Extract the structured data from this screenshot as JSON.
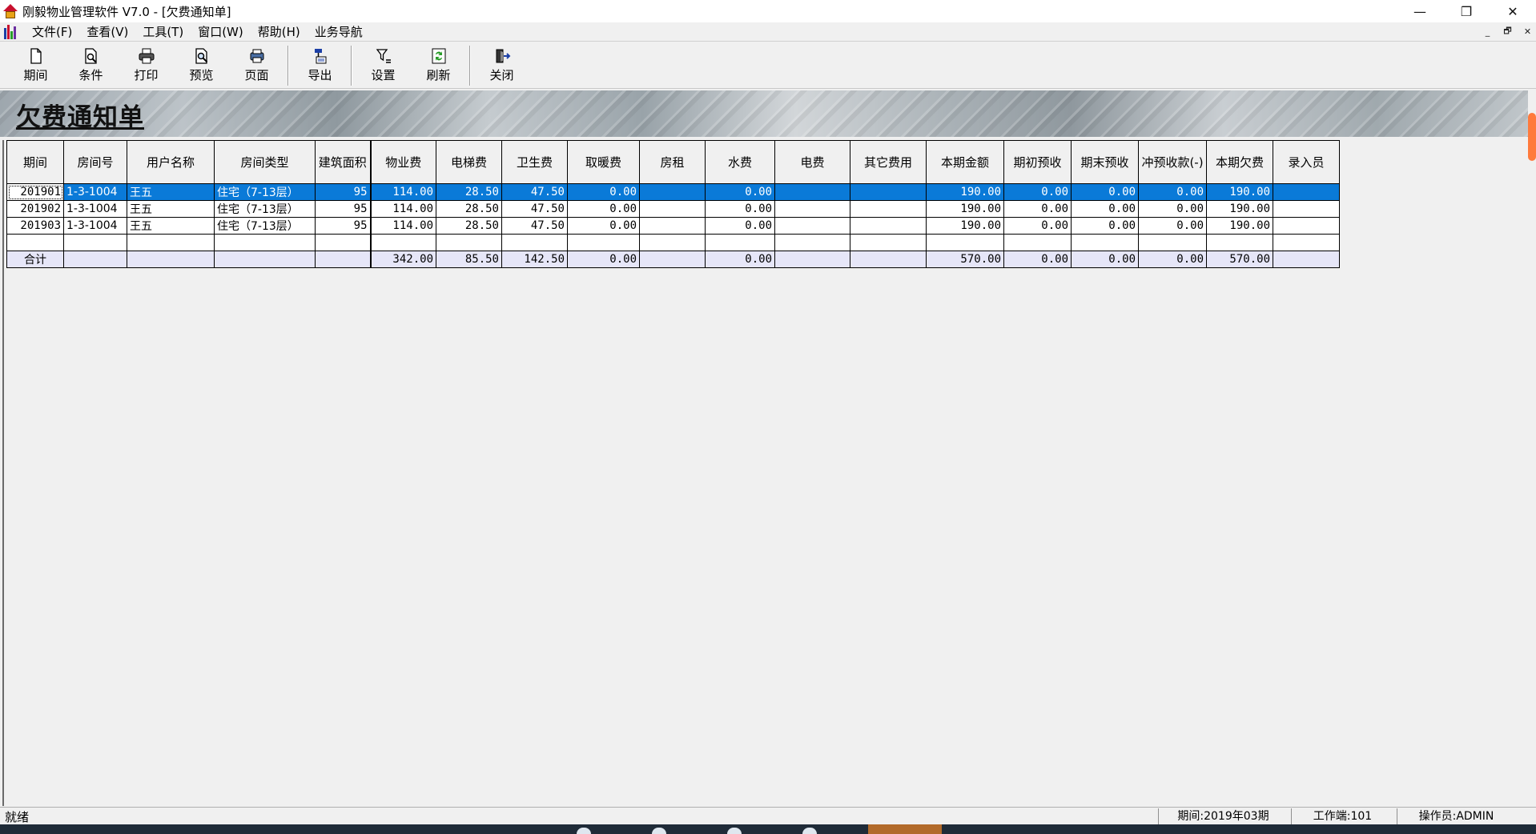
{
  "window": {
    "title": "刚毅物业管理软件 V7.0 - [欠费通知单]",
    "controls": {
      "minimize": "—",
      "restore": "❐",
      "close": "✕"
    }
  },
  "menu": {
    "items": [
      "文件(F)",
      "查看(V)",
      "工具(T)",
      "窗口(W)",
      "帮助(H)",
      "业务导航"
    ],
    "mdi_controls": {
      "minimize": "_",
      "restore": "🗗",
      "close": "✕"
    }
  },
  "toolbar": {
    "buttons": [
      {
        "label": "期间",
        "icon": "document-icon"
      },
      {
        "label": "条件",
        "icon": "search-document-icon"
      },
      {
        "label": "打印",
        "icon": "printer-icon"
      },
      {
        "label": "预览",
        "icon": "preview-icon"
      },
      {
        "label": "页面",
        "icon": "page-setup-icon"
      },
      {
        "label": "导出",
        "icon": "export-icon"
      },
      {
        "label": "设置",
        "icon": "filter-settings-icon"
      },
      {
        "label": "刷新",
        "icon": "refresh-icon"
      },
      {
        "label": "关闭",
        "icon": "exit-icon"
      }
    ]
  },
  "banner": {
    "title": "欠费通知单"
  },
  "table": {
    "columns": [
      "期间",
      "房间号",
      "用户名称",
      "房间类型",
      "建筑面积",
      "物业费",
      "电梯费",
      "卫生费",
      "取暖费",
      "房租",
      "水费",
      "电费",
      "其它费用",
      "本期金额",
      "期初预收",
      "期末预收",
      "冲预收款(-)",
      "本期欠费",
      "录入员"
    ],
    "rows": [
      [
        "201901",
        "1-3-1004",
        "王五",
        "住宅（7-13层）",
        "95",
        "114.00",
        "28.50",
        "47.50",
        "0.00",
        "",
        "0.00",
        "",
        "",
        "190.00",
        "0.00",
        "0.00",
        "0.00",
        "190.00",
        ""
      ],
      [
        "201902",
        "1-3-1004",
        "王五",
        "住宅（7-13层）",
        "95",
        "114.00",
        "28.50",
        "47.50",
        "0.00",
        "",
        "0.00",
        "",
        "",
        "190.00",
        "0.00",
        "0.00",
        "0.00",
        "190.00",
        ""
      ],
      [
        "201903",
        "1-3-1004",
        "王五",
        "住宅（7-13层）",
        "95",
        "114.00",
        "28.50",
        "47.50",
        "0.00",
        "",
        "0.00",
        "",
        "",
        "190.00",
        "0.00",
        "0.00",
        "0.00",
        "190.00",
        ""
      ],
      [
        "",
        "",
        "",
        "",
        "",
        "",
        "",
        "",
        "",
        "",
        "",
        "",
        "",
        "",
        "",
        "",
        "",
        "",
        ""
      ]
    ],
    "total": [
      "合计",
      "",
      "",
      "",
      "",
      "342.00",
      "85.50",
      "142.50",
      "0.00",
      "",
      "0.00",
      "",
      "",
      "570.00",
      "0.00",
      "0.00",
      "0.00",
      "570.00",
      ""
    ],
    "selected_row": 0
  },
  "status": {
    "ready": "就绪",
    "period": "期间:2019年03期",
    "workstation": "工作端:101",
    "operator": "操作员:ADMIN"
  },
  "colors": {
    "selection": "#0a7ad8",
    "total_row": "#e6e6f8",
    "scroll_thumb": "#ff7a3c"
  }
}
